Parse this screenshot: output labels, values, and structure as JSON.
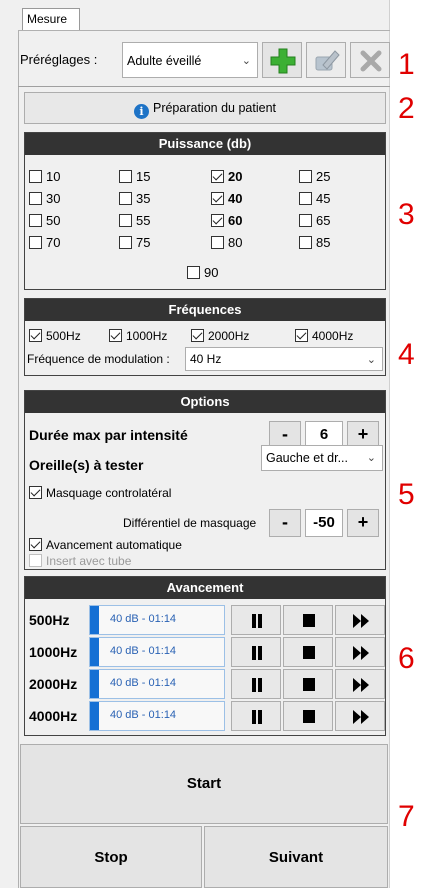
{
  "tab": {
    "label": "Mesure"
  },
  "presets": {
    "label": "Préréglages :",
    "selected": "Adulte éveillé"
  },
  "prep_button": {
    "label": "Préparation du patient"
  },
  "power": {
    "title": "Puissance (db)",
    "levels": [
      {
        "label": "10",
        "checked": false
      },
      {
        "label": "15",
        "checked": false
      },
      {
        "label": "20",
        "checked": true
      },
      {
        "label": "25",
        "checked": false
      },
      {
        "label": "30",
        "checked": false
      },
      {
        "label": "35",
        "checked": false
      },
      {
        "label": "40",
        "checked": true
      },
      {
        "label": "45",
        "checked": false
      },
      {
        "label": "50",
        "checked": false
      },
      {
        "label": "55",
        "checked": false
      },
      {
        "label": "60",
        "checked": true
      },
      {
        "label": "65",
        "checked": false
      },
      {
        "label": "70",
        "checked": false
      },
      {
        "label": "75",
        "checked": false
      },
      {
        "label": "80",
        "checked": false
      },
      {
        "label": "85",
        "checked": false
      },
      {
        "label": "90",
        "checked": false
      }
    ]
  },
  "frequencies": {
    "title": "Fréquences",
    "items": [
      {
        "label": "500Hz",
        "checked": true
      },
      {
        "label": "1000Hz",
        "checked": true
      },
      {
        "label": "2000Hz",
        "checked": true
      },
      {
        "label": "4000Hz",
        "checked": true
      }
    ],
    "modulation_label": "Fréquence de modulation :",
    "modulation_value": "40 Hz"
  },
  "options": {
    "title": "Options",
    "max_duration_label": "Durée max par intensité",
    "max_duration_value": "6",
    "minus": "-",
    "plus": "+",
    "ears_label": "Oreille(s) à tester",
    "ears_value": "Gauche et dr...",
    "contralateral_masking": {
      "label": "Masquage controlatéral",
      "checked": true
    },
    "masking_diff_label": "Différentiel de masquage",
    "masking_diff_value": "-50",
    "auto_advance": {
      "label": "Avancement automatique",
      "checked": true
    },
    "insert_tube": {
      "label": "Insert avec tube",
      "checked": false,
      "disabled": true
    }
  },
  "progress": {
    "title": "Avancement",
    "rows": [
      {
        "freq": "500Hz",
        "status": "40 dB - 01:14",
        "fill": 0.07
      },
      {
        "freq": "1000Hz",
        "status": "40 dB - 01:14",
        "fill": 0.07
      },
      {
        "freq": "2000Hz",
        "status": "40 dB - 01:14",
        "fill": 0.07
      },
      {
        "freq": "4000Hz",
        "status": "40 dB - 01:14",
        "fill": 0.07
      }
    ]
  },
  "actions": {
    "start": "Start",
    "stop": "Stop",
    "next": "Suivant"
  },
  "annotations": [
    "1",
    "2",
    "3",
    "4",
    "5",
    "6",
    "7"
  ],
  "colors": {
    "accent_green": "#3cb034",
    "info_blue": "#1e73c6",
    "progress_blue": "#1570d4",
    "annotation_red": "#e00000",
    "header_dark": "#333333"
  }
}
